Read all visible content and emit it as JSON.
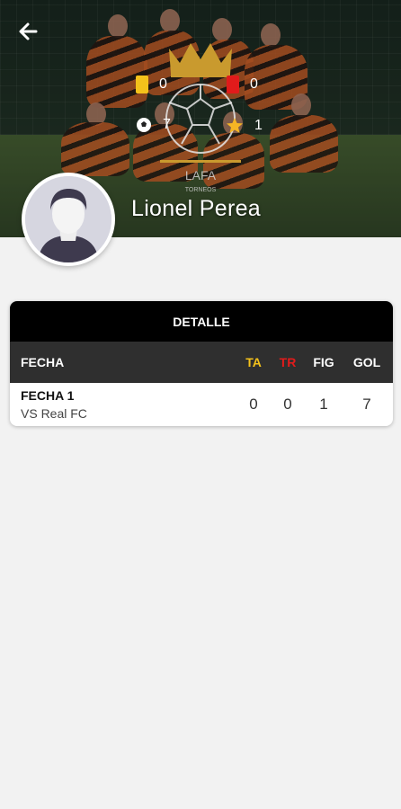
{
  "colors": {
    "accent_yellow": "#f4c21b",
    "accent_red": "#e11b1b",
    "table_title_bg": "#000000",
    "table_header_bg": "#2f2f2f",
    "page_bg": "#f2f2f2"
  },
  "header": {
    "back_icon": "arrow-left-icon",
    "player_name": "Lionel Perea",
    "avatar_icon": "default-avatar-icon",
    "crest_icon": "league-crest-icon",
    "stats": {
      "yellow_cards": "0",
      "red_cards": "0",
      "goals": "7",
      "mvp": "1"
    }
  },
  "detail": {
    "title": "DETALLE",
    "columns": {
      "fecha": "FECHA",
      "ta": "TA",
      "tr": "TR",
      "fig": "FIG",
      "gol": "GOL"
    },
    "rows": [
      {
        "title": "FECHA 1",
        "opponent": "VS Real FC",
        "ta": "0",
        "tr": "0",
        "fig": "1",
        "gol": "7"
      }
    ]
  }
}
